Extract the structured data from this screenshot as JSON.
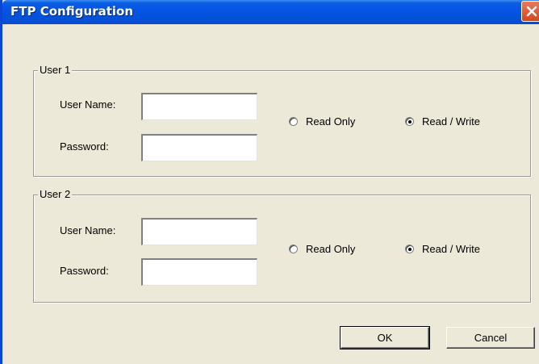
{
  "window": {
    "title": "FTP Configuration"
  },
  "user1": {
    "legend": "User 1",
    "username_label": "User Name:",
    "password_label": "Password:",
    "username_value": "",
    "password_value": "",
    "read_only_label": "Read Only",
    "read_write_label": "Read / Write",
    "selected": "Read / Write"
  },
  "user2": {
    "legend": "User 2",
    "username_label": "User Name:",
    "password_label": "Password:",
    "username_value": "",
    "password_value": "",
    "read_only_label": "Read Only",
    "read_write_label": "Read / Write",
    "selected": "Read / Write"
  },
  "buttons": {
    "ok": "OK",
    "cancel": "Cancel"
  },
  "icons": {
    "close": "close-icon"
  },
  "colors": {
    "titlebar": "#0554e6",
    "close": "#d5441e",
    "dialog_bg": "#ece9d8"
  }
}
